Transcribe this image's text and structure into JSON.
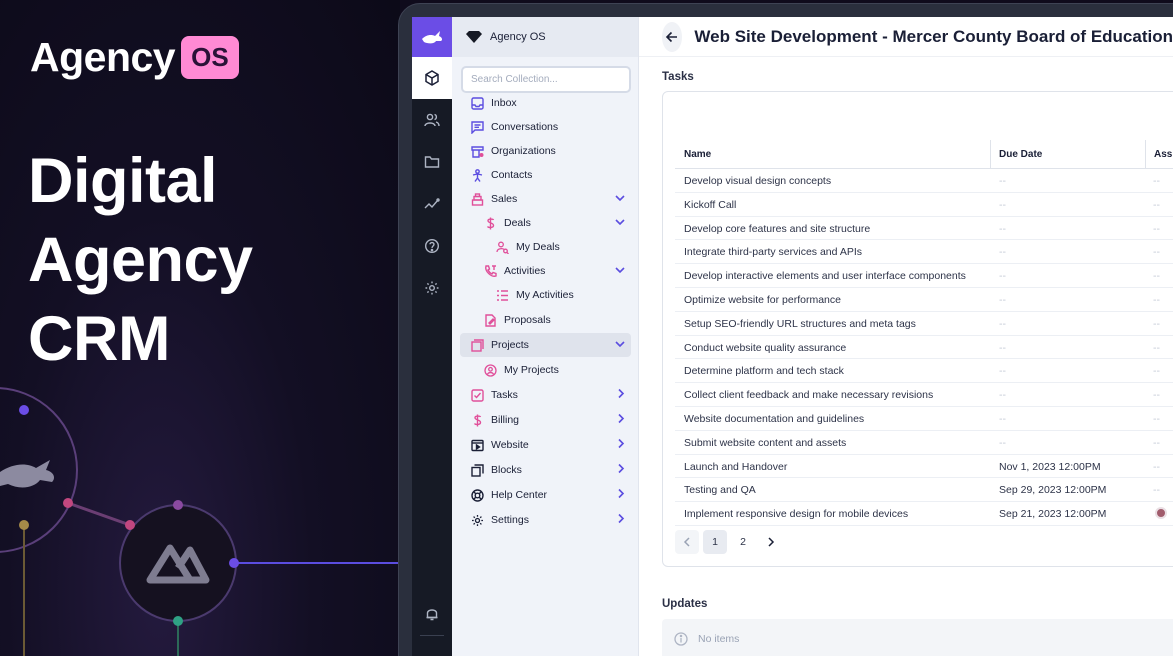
{
  "promo": {
    "brand_word": "Agency",
    "brand_badge": "OS",
    "headline": [
      "Digital",
      "Agency",
      "CRM"
    ]
  },
  "colors": {
    "accent": "#6b4de6",
    "brand_badge": "#ff8ad4",
    "nav_icon_pink": "#e04f9a",
    "nav_icon_purple": "#5b4de0"
  },
  "rail": {
    "icons": [
      "rabbit-logo-icon",
      "box-icon",
      "users-icon",
      "folder-icon",
      "insights-icon",
      "help-icon",
      "settings-icon",
      "bell-icon"
    ]
  },
  "nav": {
    "header": "Agency OS",
    "search_placeholder": "Search Collection...",
    "items": [
      {
        "label": "Inbox",
        "icon": "inbox-icon"
      },
      {
        "label": "Conversations",
        "icon": "conversation-icon"
      },
      {
        "label": "Organizations",
        "icon": "organization-icon"
      },
      {
        "label": "Contacts",
        "icon": "contact-icon"
      },
      {
        "label": "Sales",
        "icon": "sales-icon"
      },
      {
        "label": "Deals",
        "icon": "dollar-icon"
      },
      {
        "label": "My Deals",
        "icon": "person-search-icon"
      },
      {
        "label": "Activities",
        "icon": "phone-icon"
      },
      {
        "label": "My Activities",
        "icon": "list-icon"
      },
      {
        "label": "Proposals",
        "icon": "proposal-icon"
      },
      {
        "label": "Projects",
        "icon": "projects-icon"
      },
      {
        "label": "My Projects",
        "icon": "my-projects-icon"
      },
      {
        "label": "Tasks",
        "icon": "tasks-icon"
      },
      {
        "label": "Billing",
        "icon": "dollar-icon"
      },
      {
        "label": "Website",
        "icon": "website-icon"
      },
      {
        "label": "Blocks",
        "icon": "blocks-icon"
      },
      {
        "label": "Help Center",
        "icon": "help-center-icon"
      },
      {
        "label": "Settings",
        "icon": "settings-icon"
      }
    ]
  },
  "main": {
    "title": "Web Site Development - Mercer County Board of Education",
    "tasks_label": "Tasks",
    "columns": [
      "Name",
      "Due Date",
      "Ass"
    ],
    "rows": [
      {
        "name": "Develop visual design concepts",
        "due": "--",
        "assignee": "--"
      },
      {
        "name": "Kickoff Call",
        "due": "--",
        "assignee": "--"
      },
      {
        "name": "Develop core features and site structure",
        "due": "--",
        "assignee": "--"
      },
      {
        "name": "Integrate third-party services and APIs",
        "due": "--",
        "assignee": "--"
      },
      {
        "name": "Develop interactive elements and user interface components",
        "due": "--",
        "assignee": "--"
      },
      {
        "name": "Optimize website for performance",
        "due": "--",
        "assignee": "--"
      },
      {
        "name": "Setup SEO-friendly URL structures and meta tags",
        "due": "--",
        "assignee": "--"
      },
      {
        "name": "Conduct website quality assurance",
        "due": "--",
        "assignee": "--"
      },
      {
        "name": "Determine platform and tech stack",
        "due": "--",
        "assignee": "--"
      },
      {
        "name": "Collect client feedback and make necessary revisions",
        "due": "--",
        "assignee": "--"
      },
      {
        "name": "Website documentation and guidelines",
        "due": "--",
        "assignee": "--"
      },
      {
        "name": "Submit website content and assets",
        "due": "--",
        "assignee": "--"
      },
      {
        "name": "Launch and Handover",
        "due": "Nov 1, 2023 12:00PM",
        "assignee": "--"
      },
      {
        "name": "Testing and QA",
        "due": "Sep 29, 2023 12:00PM",
        "assignee": "--"
      },
      {
        "name": "Implement responsive design for mobile devices",
        "due": "Sep 21, 2023 12:00PM",
        "assignee": ""
      }
    ],
    "pagination": {
      "pages": [
        "1",
        "2"
      ]
    },
    "updates_label": "Updates",
    "updates_empty": "No items"
  }
}
